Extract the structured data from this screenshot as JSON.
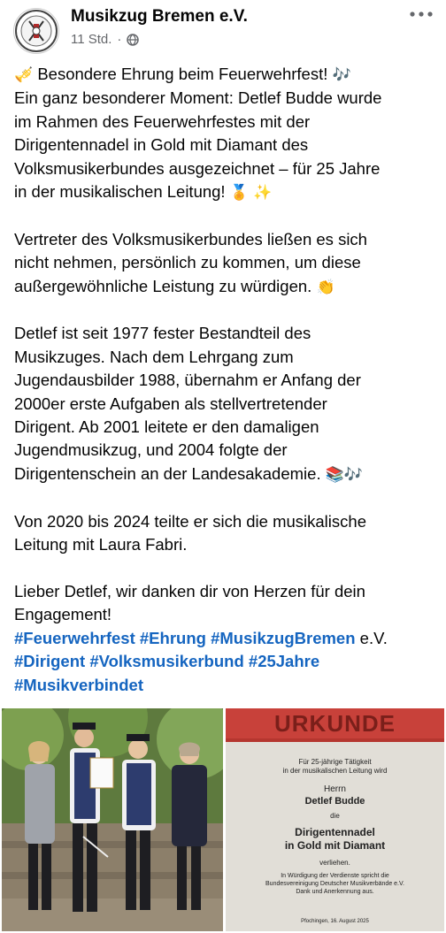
{
  "header": {
    "page_name": "Musikzug Bremen e.V.",
    "time": "11 Std.",
    "separator": "·",
    "privacy_icon": "globe-icon",
    "more_icon": "more-horizontal-icon"
  },
  "post": {
    "lines": [
      [
        "Besondere Ehrung beim Feuerwehrfest! "
      ],
      [
        "Ein ganz besonderer Moment: Detlef Budde wurde"
      ],
      [
        "im Rahmen des Feuerwehrfestes mit der"
      ],
      [
        "Dirigentennadel in Gold mit Diamant des"
      ],
      [
        "Volksmusikerbundes ausgezeichnet – für 25 Jahre"
      ],
      [
        "in der musikalischen Leitung! "
      ]
    ],
    "para1_line1": "Besondere Ehrung beim Feuerwehrfest! ",
    "para1_line2": "Ein ganz besonderer Moment: Detlef Budde wurde",
    "para1_line3": "im Rahmen des Feuerwehrfestes mit der",
    "para1_line4": "Dirigentennadel in Gold mit Diamant des",
    "para1_line5": "Volksmusikerbundes ausgezeichnet – für 25 Jahre",
    "para1_line6": "in der musikalischen Leitung! ",
    "para2_line1": "Vertreter des Volksmusikerbundes ließen es sich",
    "para2_line2": "nicht nehmen, persönlich zu kommen, um diese",
    "para2_line3": "außergewöhnliche Leistung zu würdigen. ",
    "para3_line1": "Detlef ist seit 1977 fester Bestandteil des",
    "para3_line2": "Musikzuges. Nach dem Lehrgang zum",
    "para3_line3": "Jugendausbilder 1988, übernahm er Anfang der",
    "para3_line4": "2000er erste Aufgaben als stellvertretender",
    "para3_line5": "Dirigent. Ab 2001 leitete er den damaligen",
    "para3_line6": "Jugendmusikzug, und 2004 folgte der",
    "para3_line7": "Dirigentenschein an der Landesakademie. ",
    "para4_line1": "Von 2020 bis 2024 teilte er sich die musikalische",
    "para4_line2": "Leitung mit Laura Fabri.",
    "para5_line1": "Lieber Detlef, wir danken dir von Herzen für dein",
    "para5_line2": "Engagement!",
    "hashtags": {
      "feuerwehrfest": "#Feuerwehrfest",
      "ehrung": "#Ehrung",
      "musikzugbremen": "#MusikzugBremen",
      "ev_suffix": " e.V.",
      "dirigent": "#Dirigent",
      "volksmusikerbund": "#Volksmusikerbund",
      "jahre25": "#25Jahre",
      "musikverbindet": "#Musikverbindet"
    },
    "emojis": {
      "trumpet": "🎺",
      "notes": "🎶",
      "medal": "🏅",
      "sparkles": "✨",
      "clap": "👏",
      "books": "📚"
    }
  },
  "certificate": {
    "heading": "URKUNDE",
    "line1": "Für 25-jährige Tätigkeit",
    "line2": "in der musikalischen Leitung wird",
    "herrn": "Herrn",
    "name": "Detlef Budde",
    "die": "die",
    "award1": "Dirigentennadel",
    "award2": "in Gold mit Diamant",
    "verliehen": "verliehen.",
    "thanks1": "In Würdigung der Verdienste spricht die",
    "thanks2": "Bundesvereinigung Deutscher Musikverbände e.V.",
    "thanks3": "Dank und Anerkennung aus.",
    "footer": "Pfochingen, 16. August 2025"
  },
  "colors": {
    "hashtag": "#1565c0",
    "meta": "#65676b",
    "cert_red": "#c8413a"
  }
}
